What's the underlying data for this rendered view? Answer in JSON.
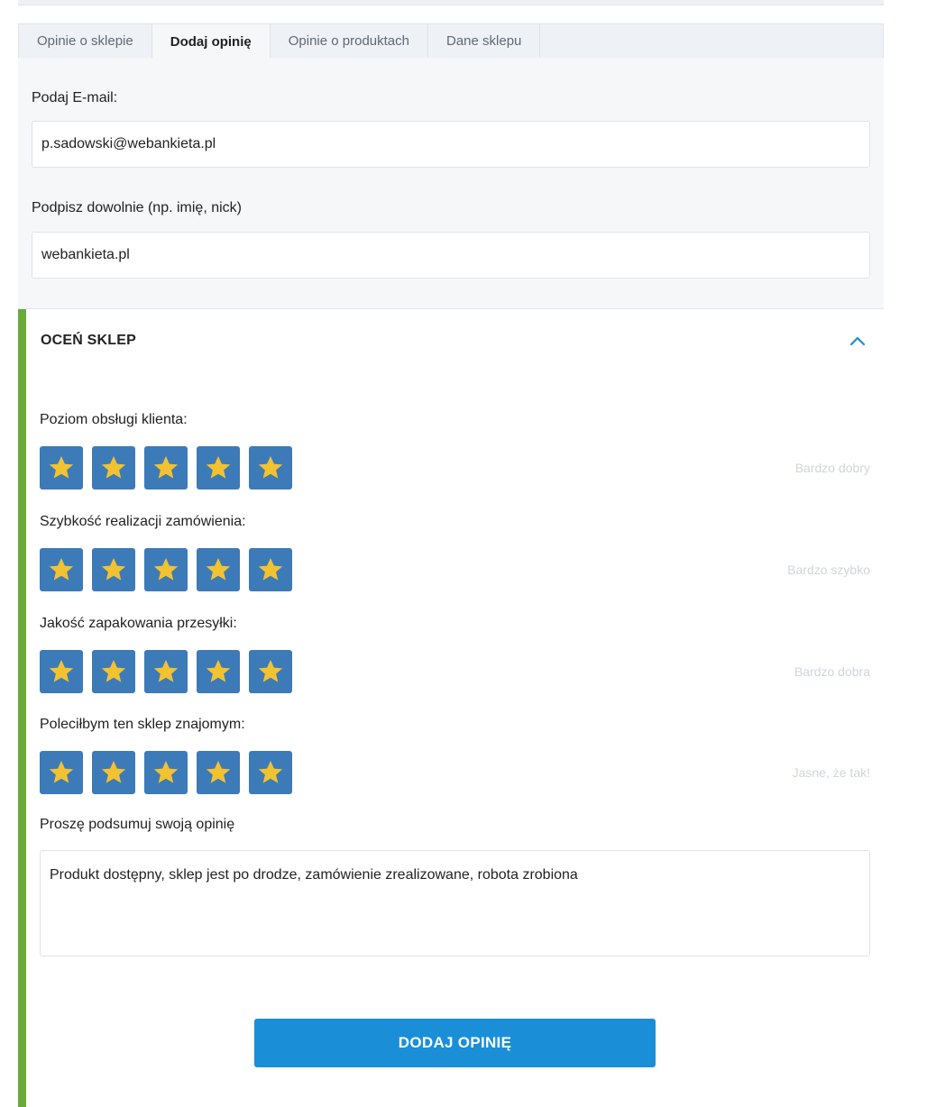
{
  "tabs": [
    {
      "label": "Opinie o sklepie"
    },
    {
      "label": "Dodaj opinię"
    },
    {
      "label": "Opinie o produktach"
    },
    {
      "label": "Dane sklepu"
    }
  ],
  "active_tab": "Dodaj opinię",
  "form": {
    "email_label": "Podaj E-mail:",
    "email_value": "p.sadowski@webankieta.pl",
    "signature_label": "Podpisz dowolnie (np. imię, nick)",
    "signature_value": "webankieta.pl"
  },
  "rating": {
    "title": "OCEŃ SKLEP",
    "questions": [
      {
        "label": "Poziom obsługi klienta:",
        "stars": 5,
        "max": 5,
        "text": "Bardzo dobry"
      },
      {
        "label": "Szybkość realizacji zamówienia:",
        "stars": 5,
        "max": 5,
        "text": "Bardzo szybko"
      },
      {
        "label": "Jakość zapakowania przesyłki:",
        "stars": 5,
        "max": 5,
        "text": "Bardzo dobra"
      },
      {
        "label": "Poleciłbym ten sklep znajomym:",
        "stars": 5,
        "max": 5,
        "text": "Jasne, że tak!"
      }
    ],
    "summary_label": "Proszę podsumuj swoją opinię",
    "summary_value": "Produkt dostępny, sklep jest po drodze, zamówienie zrealizowane, robota zrobiona",
    "submit_label": "DODAJ OPINIĘ"
  },
  "colors": {
    "accent_green": "#6aaa3a",
    "star_box": "#3d7ab8",
    "star": "#f2c230",
    "button": "#1a8fd8"
  }
}
